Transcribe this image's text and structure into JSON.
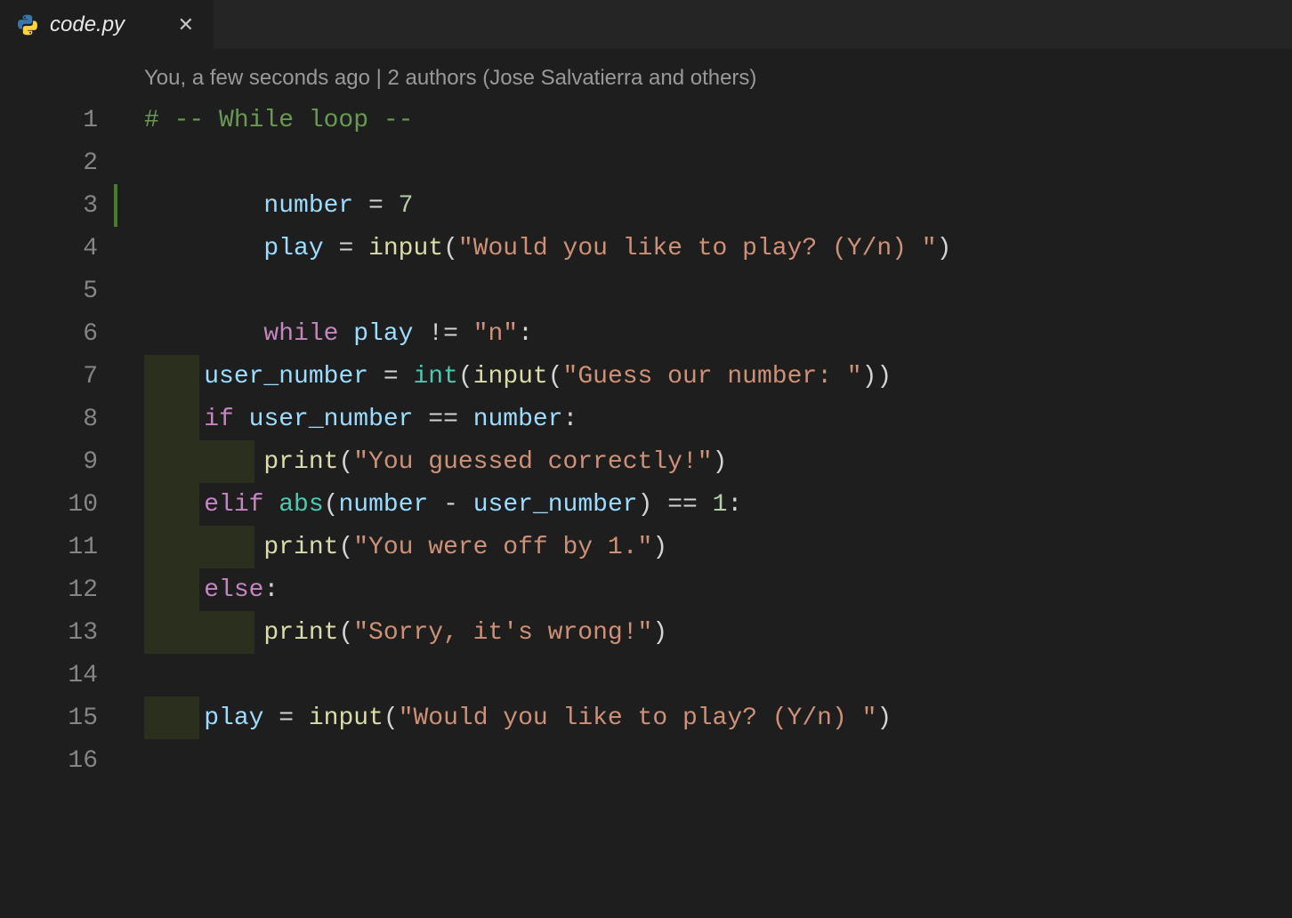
{
  "tab": {
    "filename": "code.py",
    "close_glyph": "✕",
    "icon": "python-icon"
  },
  "codelens": "You, a few seconds ago | 2 authors (Jose Salvatierra and others)",
  "gutter": {
    "l1": "1",
    "l2": "2",
    "l3": "3",
    "l4": "4",
    "l5": "5",
    "l6": "6",
    "l7": "7",
    "l8": "8",
    "l9": "9",
    "l10": "10",
    "l11": "11",
    "l12": "12",
    "l13": "13",
    "l14": "14",
    "l15": "15",
    "l16": "16"
  },
  "code": {
    "l1": {
      "comment": "# -- While loop --"
    },
    "l3": {
      "var": "number",
      "op": " = ",
      "num": "7"
    },
    "l4": {
      "var": "play",
      "op": " = ",
      "fn": "input",
      "p1": "(",
      "str": "\"Would you like to play? (Y/n) \"",
      "p2": ")"
    },
    "l6": {
      "kw": "while",
      "sp": " ",
      "var": "play",
      "op": " != ",
      "str": "\"n\"",
      "colon": ":"
    },
    "l7": {
      "var": "user_number",
      "op": " = ",
      "bi": "int",
      "p1": "(",
      "fn": "input",
      "p2": "(",
      "str": "\"Guess our number: \"",
      "p3": "))"
    },
    "l8": {
      "kw": "if",
      "sp": " ",
      "var": "user_number",
      "op": " == ",
      "var2": "number",
      "colon": ":"
    },
    "l9": {
      "fn": "print",
      "p1": "(",
      "str": "\"You guessed correctly!\"",
      "p2": ")"
    },
    "l10": {
      "kw": "elif",
      "sp": " ",
      "bi": "abs",
      "p1": "(",
      "var": "number",
      "op": " - ",
      "var2": "user_number",
      "p2": ")",
      "op2": " == ",
      "num": "1",
      "colon": ":"
    },
    "l11": {
      "fn": "print",
      "p1": "(",
      "str": "\"You were off by 1.\"",
      "p2": ")"
    },
    "l12": {
      "kw": "else",
      "colon": ":"
    },
    "l13": {
      "fn": "print",
      "p1": "(",
      "str": "\"Sorry, it's wrong!\"",
      "p2": ")"
    },
    "l15": {
      "var": "play",
      "op": " = ",
      "fn": "input",
      "p1": "(",
      "str": "\"Would you like to play? (Y/n) \"",
      "p2": ")"
    }
  },
  "indent": {
    "one": "    ",
    "two": "        "
  },
  "diff_highlight_chars": {
    "one_level": 4,
    "two_level": 8
  }
}
